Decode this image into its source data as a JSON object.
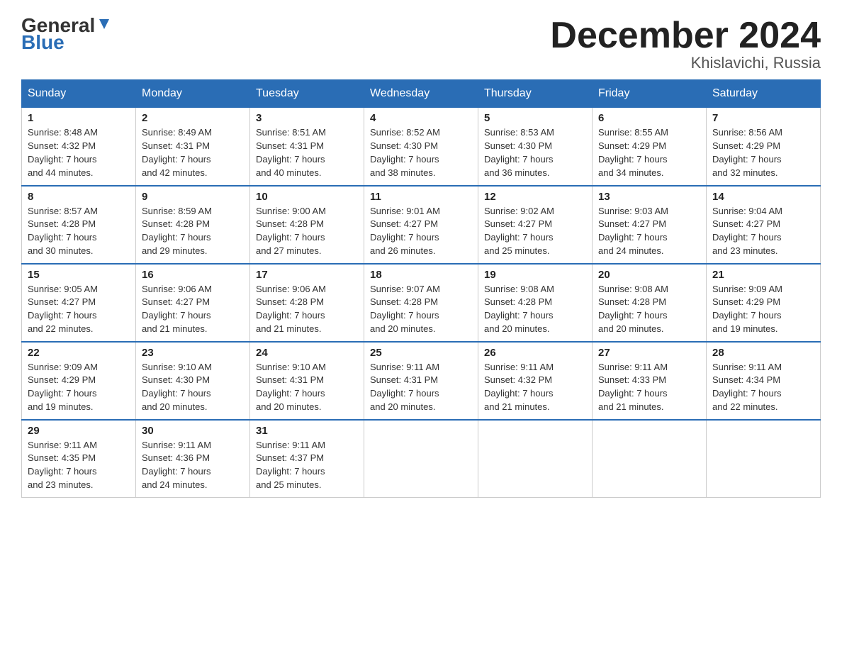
{
  "header": {
    "logo_general": "General",
    "logo_blue": "Blue",
    "month_title": "December 2024",
    "location": "Khislavichi, Russia"
  },
  "days_of_week": [
    "Sunday",
    "Monday",
    "Tuesday",
    "Wednesday",
    "Thursday",
    "Friday",
    "Saturday"
  ],
  "weeks": [
    [
      {
        "day": "1",
        "sunrise": "8:48 AM",
        "sunset": "4:32 PM",
        "daylight": "7 hours and 44 minutes."
      },
      {
        "day": "2",
        "sunrise": "8:49 AM",
        "sunset": "4:31 PM",
        "daylight": "7 hours and 42 minutes."
      },
      {
        "day": "3",
        "sunrise": "8:51 AM",
        "sunset": "4:31 PM",
        "daylight": "7 hours and 40 minutes."
      },
      {
        "day": "4",
        "sunrise": "8:52 AM",
        "sunset": "4:30 PM",
        "daylight": "7 hours and 38 minutes."
      },
      {
        "day": "5",
        "sunrise": "8:53 AM",
        "sunset": "4:30 PM",
        "daylight": "7 hours and 36 minutes."
      },
      {
        "day": "6",
        "sunrise": "8:55 AM",
        "sunset": "4:29 PM",
        "daylight": "7 hours and 34 minutes."
      },
      {
        "day": "7",
        "sunrise": "8:56 AM",
        "sunset": "4:29 PM",
        "daylight": "7 hours and 32 minutes."
      }
    ],
    [
      {
        "day": "8",
        "sunrise": "8:57 AM",
        "sunset": "4:28 PM",
        "daylight": "7 hours and 30 minutes."
      },
      {
        "day": "9",
        "sunrise": "8:59 AM",
        "sunset": "4:28 PM",
        "daylight": "7 hours and 29 minutes."
      },
      {
        "day": "10",
        "sunrise": "9:00 AM",
        "sunset": "4:28 PM",
        "daylight": "7 hours and 27 minutes."
      },
      {
        "day": "11",
        "sunrise": "9:01 AM",
        "sunset": "4:27 PM",
        "daylight": "7 hours and 26 minutes."
      },
      {
        "day": "12",
        "sunrise": "9:02 AM",
        "sunset": "4:27 PM",
        "daylight": "7 hours and 25 minutes."
      },
      {
        "day": "13",
        "sunrise": "9:03 AM",
        "sunset": "4:27 PM",
        "daylight": "7 hours and 24 minutes."
      },
      {
        "day": "14",
        "sunrise": "9:04 AM",
        "sunset": "4:27 PM",
        "daylight": "7 hours and 23 minutes."
      }
    ],
    [
      {
        "day": "15",
        "sunrise": "9:05 AM",
        "sunset": "4:27 PM",
        "daylight": "7 hours and 22 minutes."
      },
      {
        "day": "16",
        "sunrise": "9:06 AM",
        "sunset": "4:27 PM",
        "daylight": "7 hours and 21 minutes."
      },
      {
        "day": "17",
        "sunrise": "9:06 AM",
        "sunset": "4:28 PM",
        "daylight": "7 hours and 21 minutes."
      },
      {
        "day": "18",
        "sunrise": "9:07 AM",
        "sunset": "4:28 PM",
        "daylight": "7 hours and 20 minutes."
      },
      {
        "day": "19",
        "sunrise": "9:08 AM",
        "sunset": "4:28 PM",
        "daylight": "7 hours and 20 minutes."
      },
      {
        "day": "20",
        "sunrise": "9:08 AM",
        "sunset": "4:28 PM",
        "daylight": "7 hours and 20 minutes."
      },
      {
        "day": "21",
        "sunrise": "9:09 AM",
        "sunset": "4:29 PM",
        "daylight": "7 hours and 19 minutes."
      }
    ],
    [
      {
        "day": "22",
        "sunrise": "9:09 AM",
        "sunset": "4:29 PM",
        "daylight": "7 hours and 19 minutes."
      },
      {
        "day": "23",
        "sunrise": "9:10 AM",
        "sunset": "4:30 PM",
        "daylight": "7 hours and 20 minutes."
      },
      {
        "day": "24",
        "sunrise": "9:10 AM",
        "sunset": "4:31 PM",
        "daylight": "7 hours and 20 minutes."
      },
      {
        "day": "25",
        "sunrise": "9:11 AM",
        "sunset": "4:31 PM",
        "daylight": "7 hours and 20 minutes."
      },
      {
        "day": "26",
        "sunrise": "9:11 AM",
        "sunset": "4:32 PM",
        "daylight": "7 hours and 21 minutes."
      },
      {
        "day": "27",
        "sunrise": "9:11 AM",
        "sunset": "4:33 PM",
        "daylight": "7 hours and 21 minutes."
      },
      {
        "day": "28",
        "sunrise": "9:11 AM",
        "sunset": "4:34 PM",
        "daylight": "7 hours and 22 minutes."
      }
    ],
    [
      {
        "day": "29",
        "sunrise": "9:11 AM",
        "sunset": "4:35 PM",
        "daylight": "7 hours and 23 minutes."
      },
      {
        "day": "30",
        "sunrise": "9:11 AM",
        "sunset": "4:36 PM",
        "daylight": "7 hours and 24 minutes."
      },
      {
        "day": "31",
        "sunrise": "9:11 AM",
        "sunset": "4:37 PM",
        "daylight": "7 hours and 25 minutes."
      },
      null,
      null,
      null,
      null
    ]
  ],
  "labels": {
    "sunrise": "Sunrise:",
    "sunset": "Sunset:",
    "daylight": "Daylight:"
  }
}
